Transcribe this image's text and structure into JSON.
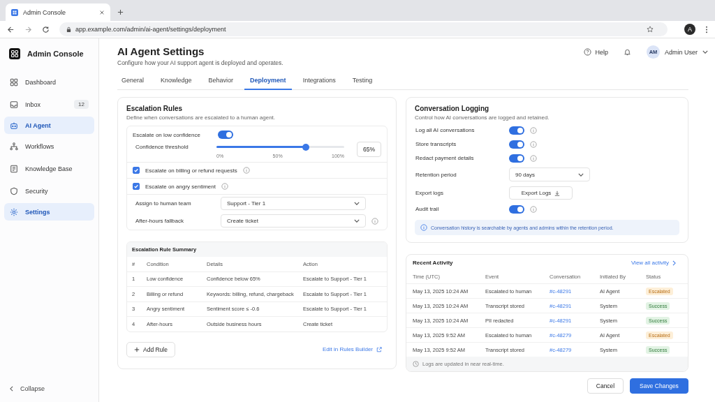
{
  "browser": {
    "tab_title": "Admin Console",
    "url": "app.example.com/admin/ai-agent/settings/deployment",
    "profile": "A"
  },
  "sidebar": {
    "app_name": "Admin Console",
    "items": [
      {
        "label": "Dashboard",
        "selected": false
      },
      {
        "label": "Inbox",
        "selected": false,
        "badge": "12"
      },
      {
        "label": "AI Agent",
        "selected": true
      },
      {
        "label": "Workflows",
        "selected": false
      },
      {
        "label": "Knowledge Base",
        "selected": false
      },
      {
        "label": "Security",
        "selected": false
      },
      {
        "label": "Settings",
        "selected": true
      }
    ],
    "collapse": "Collapse"
  },
  "header": {
    "title": "AI Agent Settings",
    "subtitle": "Configure how your AI support agent is deployed and operates.",
    "help": "Help",
    "user_initials": "AM",
    "user_name": "Admin User"
  },
  "tabs": [
    {
      "label": "General",
      "selected": false
    },
    {
      "label": "Knowledge",
      "selected": false
    },
    {
      "label": "Behavior",
      "selected": false
    },
    {
      "label": "Deployment",
      "selected": true
    },
    {
      "label": "Integrations",
      "selected": false
    },
    {
      "label": "Testing",
      "selected": false
    }
  ],
  "escalation": {
    "title": "Escalation Rules",
    "subtitle": "Define when conversations are escalated to a human agent.",
    "low_confidence": {
      "label": "Escalate on low confidence",
      "on": true
    },
    "threshold": {
      "label": "Confidence threshold",
      "level": 0.7,
      "reading": "65%",
      "ticks": [
        "0%",
        "50%",
        "100%"
      ]
    },
    "checks": [
      {
        "label": "Escalate on billing or refund requests",
        "checked": true
      },
      {
        "label": "Escalate on angry sentiment",
        "checked": true
      }
    ],
    "selects": [
      {
        "label": "Assign to human team",
        "value": "Support - Tier 1",
        "info": false
      },
      {
        "label": "After-hours fallback",
        "value": "Create ticket",
        "info": true
      }
    ],
    "summary": {
      "title": "Escalation Rule Summary",
      "columns": [
        "#",
        "Condition",
        "Details",
        "Action"
      ],
      "rows": [
        [
          "1",
          "Low confidence",
          "Confidence below 65%",
          "Escalate to Support - Tier 1"
        ],
        [
          "2",
          "Billing or refund",
          "Keywords: billing, refund, chargeback",
          "Escalate to Support - Tier 1"
        ],
        [
          "3",
          "Angry sentiment",
          "Sentiment score ≤ -0.6",
          "Escalate to Support - Tier 1"
        ],
        [
          "4",
          "After-hours",
          "Outside business hours",
          "Create ticket"
        ]
      ]
    },
    "add_rule": "Add Rule",
    "edit_link": "Edit in Rules Builder"
  },
  "logging": {
    "title": "Conversation Logging",
    "subtitle": "Control how AI conversations are logged and retained.",
    "settings": [
      {
        "kind": "toggle",
        "label": "Log all AI conversations",
        "on": true
      },
      {
        "kind": "toggle",
        "label": "Store transcripts",
        "on": true
      },
      {
        "kind": "toggle",
        "label": "Redact payment details",
        "on": true
      },
      {
        "kind": "select",
        "label": "Retention period",
        "value": "90 days"
      },
      {
        "kind": "button",
        "label": "Export logs",
        "value": "Export Logs"
      },
      {
        "kind": "toggle",
        "label": "Audit trail",
        "on": true
      }
    ],
    "note": "Conversation history is searchable by agents and admins within the retention period."
  },
  "activity": {
    "title": "Recent Activity",
    "view_all": "View all activity",
    "columns": [
      "Time (UTC)",
      "Event",
      "Conversation",
      "Initiated By",
      "Status"
    ],
    "rows": [
      {
        "time": "May 13, 2025 10:24 AM",
        "event": "Escalated to human",
        "conversation": "#c-48291",
        "initiated_by": "AI Agent",
        "status": "Escalated",
        "kind": "warning"
      },
      {
        "time": "May 13, 2025 10:24 AM",
        "event": "Transcript stored",
        "conversation": "#c-48291",
        "initiated_by": "System",
        "status": "Success",
        "kind": "success"
      },
      {
        "time": "May 13, 2025 10:24 AM",
        "event": "PII redacted",
        "conversation": "#c-48291",
        "initiated_by": "System",
        "status": "Success",
        "kind": "success"
      },
      {
        "time": "May 13, 2025 9:52 AM",
        "event": "Escalated to human",
        "conversation": "#c-48279",
        "initiated_by": "AI Agent",
        "status": "Escalated",
        "kind": "warning"
      },
      {
        "time": "May 13, 2025 9:52 AM",
        "event": "Transcript stored",
        "conversation": "#c-48279",
        "initiated_by": "System",
        "status": "Success",
        "kind": "success"
      }
    ],
    "footer": "Logs are updated in near real-time."
  },
  "buttons": {
    "cancel": "Cancel",
    "save": "Save Changes"
  }
}
